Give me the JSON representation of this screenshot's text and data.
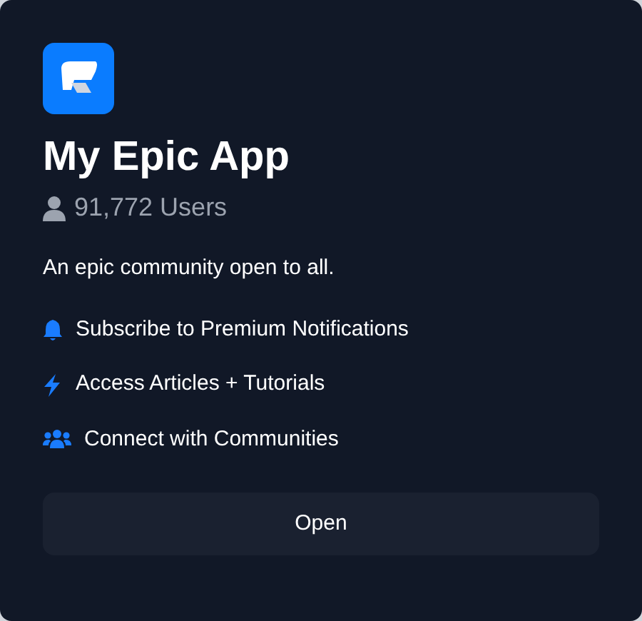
{
  "app": {
    "name": "My Epic App",
    "users": "91,772 Users",
    "description": "An epic community open to all."
  },
  "features": [
    {
      "kind": "bell",
      "label": "Subscribe to Premium Notifications"
    },
    {
      "kind": "bolt",
      "label": "Access Articles + Tutorials"
    },
    {
      "kind": "users",
      "label": "Connect with Communities"
    }
  ],
  "button": {
    "label": "Open"
  }
}
